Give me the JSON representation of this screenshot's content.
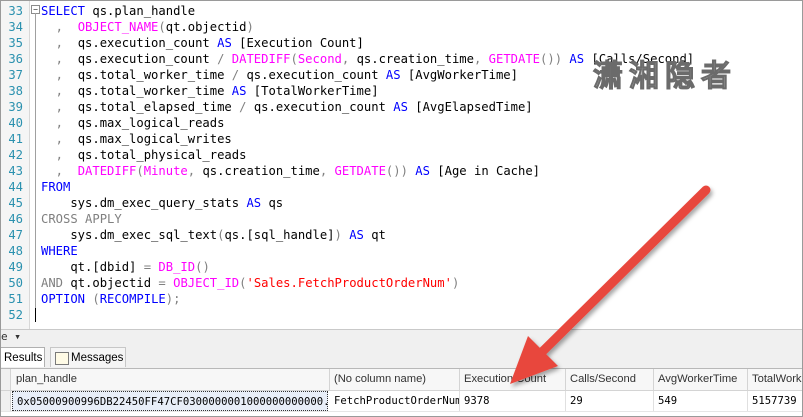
{
  "editor": {
    "lines": [
      {
        "num": "33",
        "tokens": [
          {
            "t": "SELECT ",
            "c": "kw"
          },
          {
            "t": "qs.plan_handle",
            "c": ""
          }
        ]
      },
      {
        "num": "34",
        "tokens": [
          {
            "t": "  ,  ",
            "c": "op"
          },
          {
            "t": "OBJECT_NAME",
            "c": "fn"
          },
          {
            "t": "(",
            "c": "op"
          },
          {
            "t": "qt.objectid",
            "c": ""
          },
          {
            "t": ")",
            "c": "op"
          }
        ]
      },
      {
        "num": "35",
        "tokens": [
          {
            "t": "  ,  ",
            "c": "op"
          },
          {
            "t": "qs.execution_count ",
            "c": ""
          },
          {
            "t": "AS ",
            "c": "kw"
          },
          {
            "t": "[Execution Count]",
            "c": ""
          }
        ]
      },
      {
        "num": "36",
        "tokens": [
          {
            "t": "  ,  ",
            "c": "op"
          },
          {
            "t": "qs.execution_count ",
            "c": ""
          },
          {
            "t": "/ ",
            "c": "op"
          },
          {
            "t": "DATEDIFF",
            "c": "fn"
          },
          {
            "t": "(",
            "c": "op"
          },
          {
            "t": "Second",
            "c": "fn"
          },
          {
            "t": ", ",
            "c": "op"
          },
          {
            "t": "qs.creation_time",
            "c": ""
          },
          {
            "t": ", ",
            "c": "op"
          },
          {
            "t": "GETDATE",
            "c": "fn"
          },
          {
            "t": "()) ",
            "c": "op"
          },
          {
            "t": "AS ",
            "c": "kw"
          },
          {
            "t": "[Calls/Second]",
            "c": ""
          }
        ]
      },
      {
        "num": "37",
        "tokens": [
          {
            "t": "  ,  ",
            "c": "op"
          },
          {
            "t": "qs.total_worker_time ",
            "c": ""
          },
          {
            "t": "/ ",
            "c": "op"
          },
          {
            "t": "qs.execution_count ",
            "c": ""
          },
          {
            "t": "AS ",
            "c": "kw"
          },
          {
            "t": "[AvgWorkerTime]",
            "c": ""
          }
        ]
      },
      {
        "num": "38",
        "tokens": [
          {
            "t": "  ,  ",
            "c": "op"
          },
          {
            "t": "qs.total_worker_time ",
            "c": ""
          },
          {
            "t": "AS ",
            "c": "kw"
          },
          {
            "t": "[TotalWorkerTime]",
            "c": ""
          }
        ]
      },
      {
        "num": "39",
        "tokens": [
          {
            "t": "  ,  ",
            "c": "op"
          },
          {
            "t": "qs.total_elapsed_time ",
            "c": ""
          },
          {
            "t": "/ ",
            "c": "op"
          },
          {
            "t": "qs.execution_count ",
            "c": ""
          },
          {
            "t": "AS ",
            "c": "kw"
          },
          {
            "t": "[AvgElapsedTime]",
            "c": ""
          }
        ]
      },
      {
        "num": "40",
        "tokens": [
          {
            "t": "  ,  ",
            "c": "op"
          },
          {
            "t": "qs.max_logical_reads",
            "c": ""
          }
        ]
      },
      {
        "num": "41",
        "tokens": [
          {
            "t": "  ,  ",
            "c": "op"
          },
          {
            "t": "qs.max_logical_writes",
            "c": ""
          }
        ]
      },
      {
        "num": "42",
        "tokens": [
          {
            "t": "  ,  ",
            "c": "op"
          },
          {
            "t": "qs.total_physical_reads",
            "c": ""
          }
        ]
      },
      {
        "num": "43",
        "tokens": [
          {
            "t": "  ,  ",
            "c": "op"
          },
          {
            "t": "DATEDIFF",
            "c": "fn"
          },
          {
            "t": "(",
            "c": "op"
          },
          {
            "t": "Minute",
            "c": "fn"
          },
          {
            "t": ", ",
            "c": "op"
          },
          {
            "t": "qs.creation_time",
            "c": ""
          },
          {
            "t": ", ",
            "c": "op"
          },
          {
            "t": "GETDATE",
            "c": "fn"
          },
          {
            "t": "()) ",
            "c": "op"
          },
          {
            "t": "AS ",
            "c": "kw"
          },
          {
            "t": "[Age in Cache]",
            "c": ""
          }
        ]
      },
      {
        "num": "44",
        "tokens": [
          {
            "t": "FROM",
            "c": "kw"
          }
        ]
      },
      {
        "num": "45",
        "tokens": [
          {
            "t": "    sys.dm_exec_query_stats ",
            "c": ""
          },
          {
            "t": "AS ",
            "c": "kw"
          },
          {
            "t": "qs",
            "c": ""
          }
        ]
      },
      {
        "num": "46",
        "tokens": [
          {
            "t": "CROSS APPLY",
            "c": "gray"
          }
        ]
      },
      {
        "num": "47",
        "tokens": [
          {
            "t": "    sys.dm_exec_sql_text",
            "c": ""
          },
          {
            "t": "(",
            "c": "op"
          },
          {
            "t": "qs.[sql_handle]",
            "c": ""
          },
          {
            "t": ") ",
            "c": "op"
          },
          {
            "t": "AS ",
            "c": "kw"
          },
          {
            "t": "qt",
            "c": ""
          }
        ]
      },
      {
        "num": "48",
        "tokens": [
          {
            "t": "WHERE",
            "c": "kw"
          }
        ]
      },
      {
        "num": "49",
        "tokens": [
          {
            "t": "    qt.[dbid] ",
            "c": ""
          },
          {
            "t": "= ",
            "c": "op"
          },
          {
            "t": "DB_ID",
            "c": "fn"
          },
          {
            "t": "()",
            "c": "op"
          }
        ]
      },
      {
        "num": "50",
        "tokens": [
          {
            "t": "AND ",
            "c": "gray"
          },
          {
            "t": "qt.objectid ",
            "c": ""
          },
          {
            "t": "= ",
            "c": "op"
          },
          {
            "t": "OBJECT_ID",
            "c": "fn"
          },
          {
            "t": "(",
            "c": "op"
          },
          {
            "t": "'Sales.FetchProductOrderNum'",
            "c": "str"
          },
          {
            "t": ")",
            "c": "op"
          }
        ]
      },
      {
        "num": "51",
        "tokens": [
          {
            "t": "OPTION ",
            "c": "kw"
          },
          {
            "t": "(",
            "c": "op"
          },
          {
            "t": "RECOMPILE",
            "c": "kw"
          },
          {
            "t": ");",
            "c": "op"
          }
        ]
      },
      {
        "num": "52",
        "tokens": []
      }
    ],
    "fold_glyph": "−"
  },
  "watermark": "潇湘隐者",
  "splitter_label": "e ▾",
  "tabs": [
    {
      "label": "Results"
    },
    {
      "label": "Messages"
    }
  ],
  "grid": {
    "columns": [
      "plan_handle",
      "(No column name)",
      "Execution Count",
      "Calls/Second",
      "AvgWorkerTime",
      "TotalWork"
    ],
    "row": [
      "0x05000900996DB22450FF47CF0300000001000000000000...",
      "FetchProductOrderNum",
      "9378",
      "29",
      "549",
      "5157739"
    ]
  },
  "colors": {
    "keyword": "#0000ff",
    "function": "#ff00ff",
    "string": "#ff0000",
    "operator": "#808080",
    "arrow": "#e8473c"
  }
}
